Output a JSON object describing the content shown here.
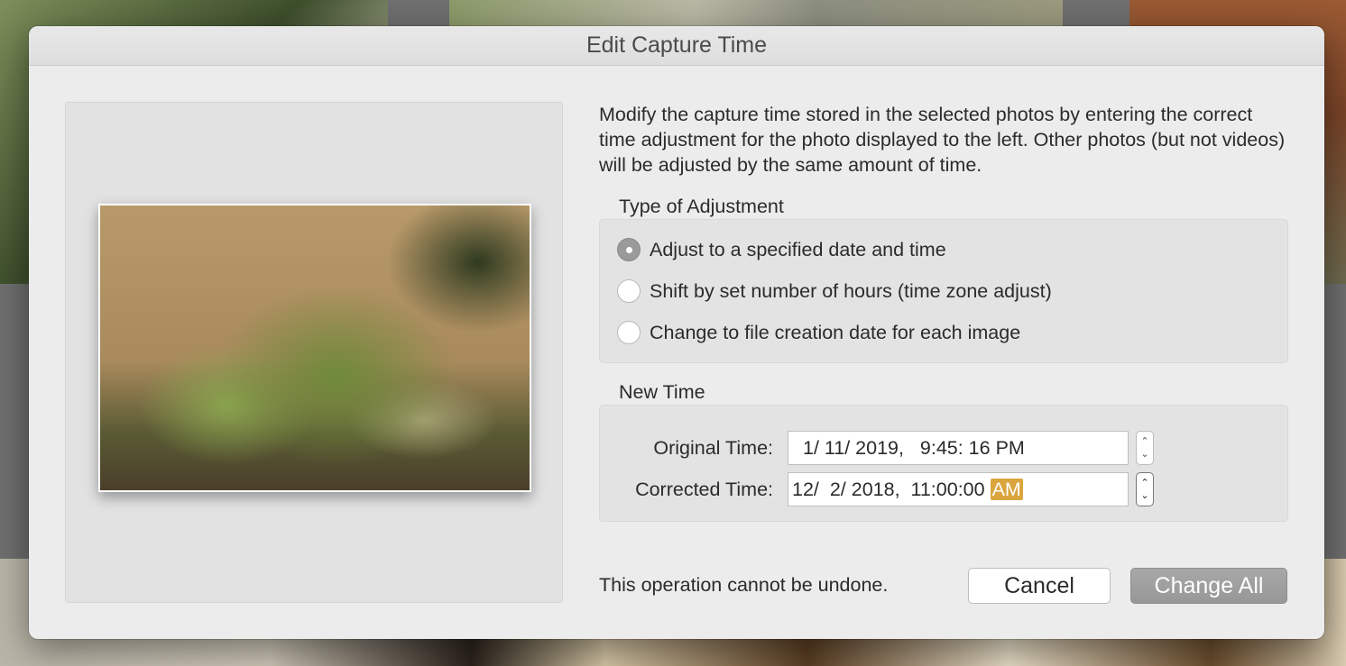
{
  "dialog": {
    "title": "Edit Capture Time",
    "description": "Modify the capture time stored in the selected photos by entering the correct time adjustment for the photo displayed to the left. Other photos (but not videos) will be adjusted by the same amount of time."
  },
  "adjustment": {
    "label": "Type of Adjustment",
    "options": [
      {
        "label": "Adjust to a specified date and time",
        "selected": true
      },
      {
        "label": "Shift by set number of hours (time zone adjust)",
        "selected": false
      },
      {
        "label": "Change to file creation date for each image",
        "selected": false
      }
    ]
  },
  "new_time": {
    "label": "New Time",
    "original_label": "Original Time:",
    "original_value": "1/ 11/ 2019,   9:45: 16 PM",
    "corrected_label": "Corrected Time:",
    "corrected_value": "12/  2/ 2018,  11:00:00 ",
    "corrected_ampm": "AM"
  },
  "footer": {
    "warning": "This operation cannot be undone.",
    "cancel_label": "Cancel",
    "change_all_label": "Change All"
  },
  "colors": {
    "selection_highlight": "#d9a53c",
    "dialog_background": "#ececec",
    "primary_button": "#9f9f9f"
  }
}
